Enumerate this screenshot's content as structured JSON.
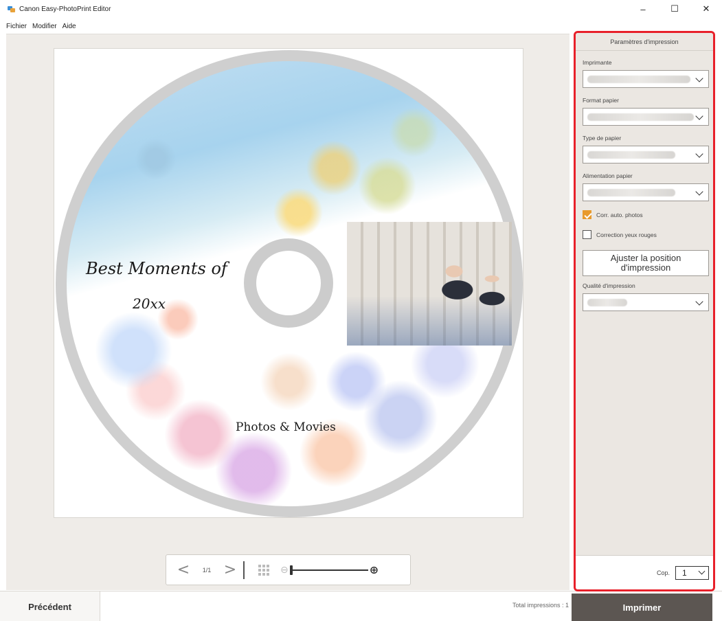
{
  "window": {
    "title": "Canon Easy-PhotoPrint Editor",
    "minimize": "–",
    "maximize": "☐",
    "close": "✕"
  },
  "menu": {
    "items": [
      "Fichier",
      "Modifier",
      "Aide"
    ]
  },
  "disc": {
    "title_line1": "Best Moments of",
    "title_line2": "20xx",
    "subtitle": "Photos & Movies"
  },
  "navigator": {
    "prev": "<",
    "page": "1/1",
    "next": ">",
    "zoom_out": "⊖",
    "zoom_in": "⊕",
    "zoom_level": 0.0
  },
  "bottom": {
    "prev_button": "Précédent",
    "total": "Total impressions : 1",
    "print_button": "Imprimer"
  },
  "panel": {
    "header": "Paramètres d'impression",
    "printer_label": "Imprimante",
    "paper_size_label": "Format papier",
    "paper_type_label": "Type de papier",
    "paper_source_label": "Alimentation papier",
    "auto_correct": {
      "label": "Corr. auto. photos",
      "checked": true
    },
    "red_eye": {
      "label": "Correction yeux rouges",
      "checked": false
    },
    "adjust_button_line1": "Ajuster la position",
    "adjust_button_line2": "d'impression",
    "quality_label": "Qualité d'impression",
    "copies_label": "Cop.",
    "copies_value": "1"
  },
  "colors": {
    "panel_border": "#e8202a",
    "print_button_bg": "#5c5652",
    "checkbox_checked": "#e89a2c"
  }
}
